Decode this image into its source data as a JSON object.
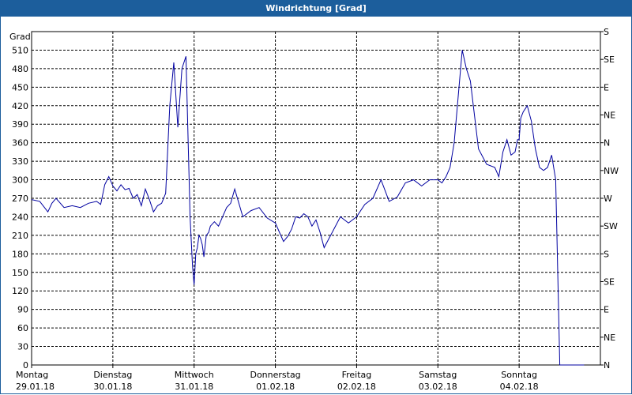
{
  "window": {
    "title": "Windrichtung [Grad]"
  },
  "colors": {
    "titlebar": "#1c5e9c",
    "line": "#0000a0",
    "grid": "#000000"
  },
  "chart_data": {
    "type": "line",
    "title": "Windrichtung [Grad]",
    "ylabel": "Grad",
    "ylim": [
      0,
      540
    ],
    "xlim": [
      0,
      7
    ],
    "grid": true,
    "y_ticks": [
      0,
      30,
      60,
      90,
      120,
      150,
      180,
      210,
      240,
      270,
      300,
      330,
      360,
      390,
      420,
      450,
      480,
      510
    ],
    "right_axis_labels": [
      "N",
      "NE",
      "E",
      "SE",
      "S",
      "SW",
      "W",
      "NW",
      "N",
      "NE",
      "E",
      "SE",
      "S"
    ],
    "x_ticks": [
      {
        "day": "Montag",
        "date": "29.01.18"
      },
      {
        "day": "Dienstag",
        "date": "30.01.18"
      },
      {
        "day": "Mittwoch",
        "date": "31.01.18"
      },
      {
        "day": "Donnerstag",
        "date": "01.02.18"
      },
      {
        "day": "Freitag",
        "date": "02.02.18"
      },
      {
        "day": "Samstag",
        "date": "03.02.18"
      },
      {
        "day": "Sonntag",
        "date": "04.02.18"
      }
    ],
    "series": [
      {
        "x": [
          0,
          0.1,
          0.2,
          0.25,
          0.3,
          0.4,
          0.5,
          0.6,
          0.7,
          0.8,
          0.85,
          0.9,
          0.95,
          1.0,
          1.05,
          1.1,
          1.15,
          1.2,
          1.25,
          1.3,
          1.35,
          1.4,
          1.45,
          1.5,
          1.55,
          1.6,
          1.65,
          1.7,
          1.75,
          1.8,
          1.85,
          1.9,
          1.95,
          1.98,
          2.0,
          2.02,
          2.04,
          2.06,
          2.08,
          2.1,
          2.12,
          2.15,
          2.18,
          2.2,
          2.25,
          2.3,
          2.35,
          2.4,
          2.45,
          2.5,
          2.6,
          2.7,
          2.8,
          2.9,
          3.0,
          3.05,
          3.1,
          3.15,
          3.2,
          3.25,
          3.3,
          3.35,
          3.4,
          3.45,
          3.5,
          3.55,
          3.6,
          3.7,
          3.8,
          3.9,
          4.0,
          4.1,
          4.2,
          4.3,
          4.4,
          4.5,
          4.6,
          4.7,
          4.8,
          4.9,
          5.0,
          5.05,
          5.1,
          5.15,
          5.2,
          5.3,
          5.35,
          5.4,
          5.5,
          5.6,
          5.7,
          5.75,
          5.8,
          5.85,
          5.9,
          5.95,
          5.98,
          6.0,
          6.02,
          6.05,
          6.1,
          6.15,
          6.2,
          6.25,
          6.3,
          6.35,
          6.4,
          6.45,
          6.5,
          6.55,
          6.6,
          6.65,
          6.7,
          6.75,
          6.8,
          6.85,
          6.9,
          6.95,
          7.0
        ],
        "values": [
          268,
          265,
          248,
          262,
          270,
          255,
          258,
          255,
          262,
          265,
          260,
          292,
          305,
          290,
          282,
          292,
          284,
          286,
          270,
          276,
          258,
          285,
          268,
          248,
          258,
          262,
          278,
          420,
          490,
          385,
          480,
          500,
          240,
          160,
          130,
          180,
          190,
          210,
          205,
          195,
          175,
          210,
          215,
          225,
          232,
          225,
          240,
          255,
          262,
          285,
          240,
          250,
          255,
          238,
          230,
          215,
          200,
          208,
          220,
          240,
          238,
          245,
          240,
          225,
          235,
          215,
          190,
          215,
          240,
          230,
          240,
          260,
          270,
          300,
          265,
          272,
          295,
          300,
          290,
          300,
          300,
          295,
          305,
          320,
          360,
          510,
          480,
          460,
          350,
          325,
          320,
          305,
          345,
          365,
          340,
          345,
          365,
          365,
          400,
          410,
          420,
          395,
          350,
          320,
          315,
          320,
          340,
          300,
          0,
          0,
          0,
          0,
          0,
          0,
          0,
          0,
          0,
          0,
          0
        ]
      }
    ]
  }
}
